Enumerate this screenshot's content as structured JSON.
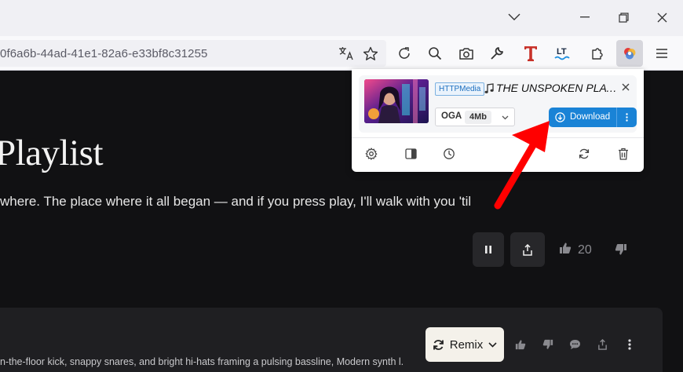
{
  "browser": {
    "url": "0f6a6b-44ad-41e1-82a6-e33bf8c31255",
    "window_controls": [
      "chevron-down-icon",
      "minimize-icon",
      "restore-icon",
      "close-icon"
    ],
    "toolbar_icons": [
      "translate-icon",
      "bookmark-star-icon",
      "reload-icon",
      "search-icon",
      "screenshot-camera-icon",
      "wrench-icon",
      "t-extension-icon",
      "languagetool-icon",
      "extensions-puzzle-icon",
      "media-downloader-extension-icon",
      "menu-icon"
    ],
    "lt_label": "LT"
  },
  "page": {
    "title": "Playlist",
    "description": "where. The place where it all began — and if you press play, I'll walk with you 'til",
    "like_count": "20",
    "song": {
      "description": "n-the-floor kick, snappy snares, and bright hi-hats framing a pulsing bassline, Modern synth l...",
      "remix_label": "Remix"
    }
  },
  "popup": {
    "media": {
      "source": "HTTPMedia",
      "title": "THE UNSPOKEN PLAYL...",
      "format": "OGA",
      "size": "4Mb",
      "download_label": "Download"
    },
    "footer_icons": [
      "settings-icon",
      "sidebar-icon",
      "history-icon",
      "refresh-icon",
      "trash-icon"
    ]
  },
  "colors": {
    "accent": "#1a83d6",
    "annotation_arrow": "#ff0000",
    "page_bg": "#111113"
  }
}
